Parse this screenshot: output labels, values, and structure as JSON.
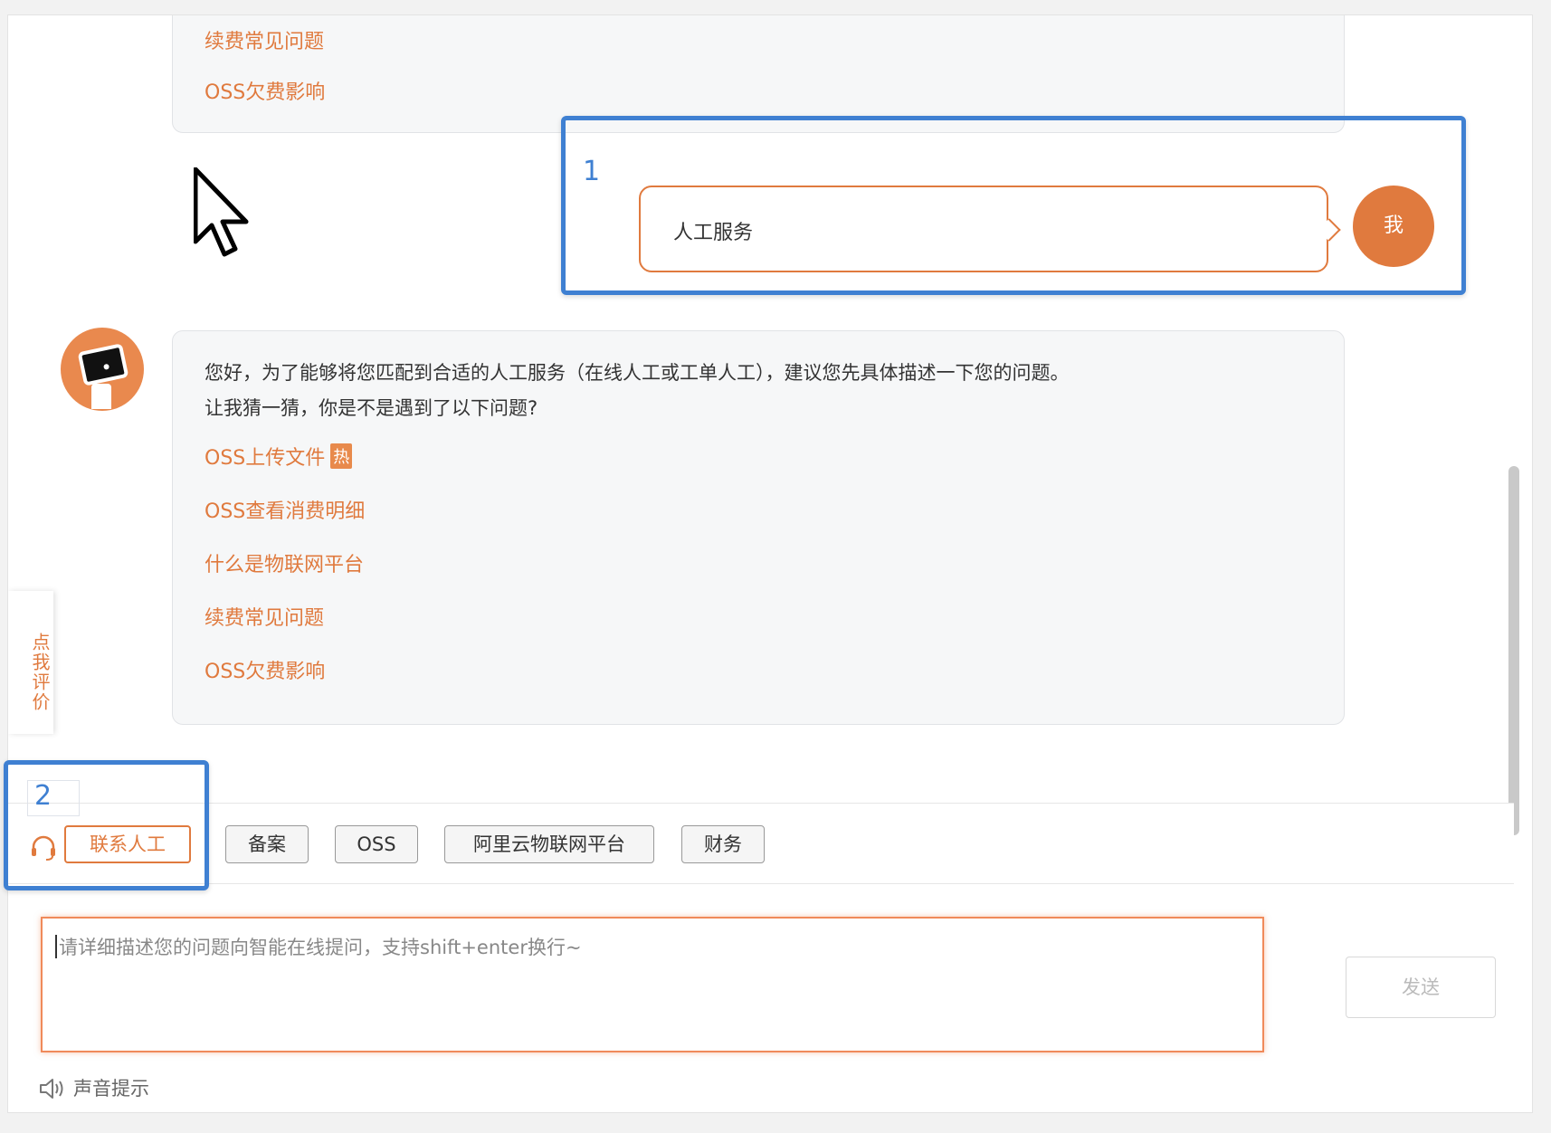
{
  "top_bubble": {
    "links": [
      "续费常见问题",
      "OSS欠费影响"
    ]
  },
  "user_message": {
    "text": "人工服务",
    "avatar_label": "我"
  },
  "bot_message": {
    "line1": "您好，为了能够将您匹配到合适的人工服务（在线人工或工单人工），建议您先具体描述一下您的问题。",
    "line2": "让我猜一猜，你是不是遇到了以下问题?",
    "hot_badge": "热",
    "links": [
      "OSS上传文件",
      "OSS查看消费明细",
      "什么是物联网平台",
      "续费常见问题",
      "OSS欠费影响"
    ]
  },
  "rate_tab": {
    "label": "点我评价"
  },
  "highlights": {
    "one": "1",
    "two": "2"
  },
  "quick_bar": {
    "contact_human": "联系人工",
    "chips": [
      "备案",
      "OSS",
      "阿里云物联网平台",
      "财务"
    ]
  },
  "composer": {
    "placeholder": "请详细描述您的问题向智能在线提问，支持shift+enter换行~",
    "send_label": "发送",
    "sound_label": "声音提示"
  },
  "colors": {
    "accent": "#e07a3e",
    "highlight_blue": "#3f80d2"
  }
}
